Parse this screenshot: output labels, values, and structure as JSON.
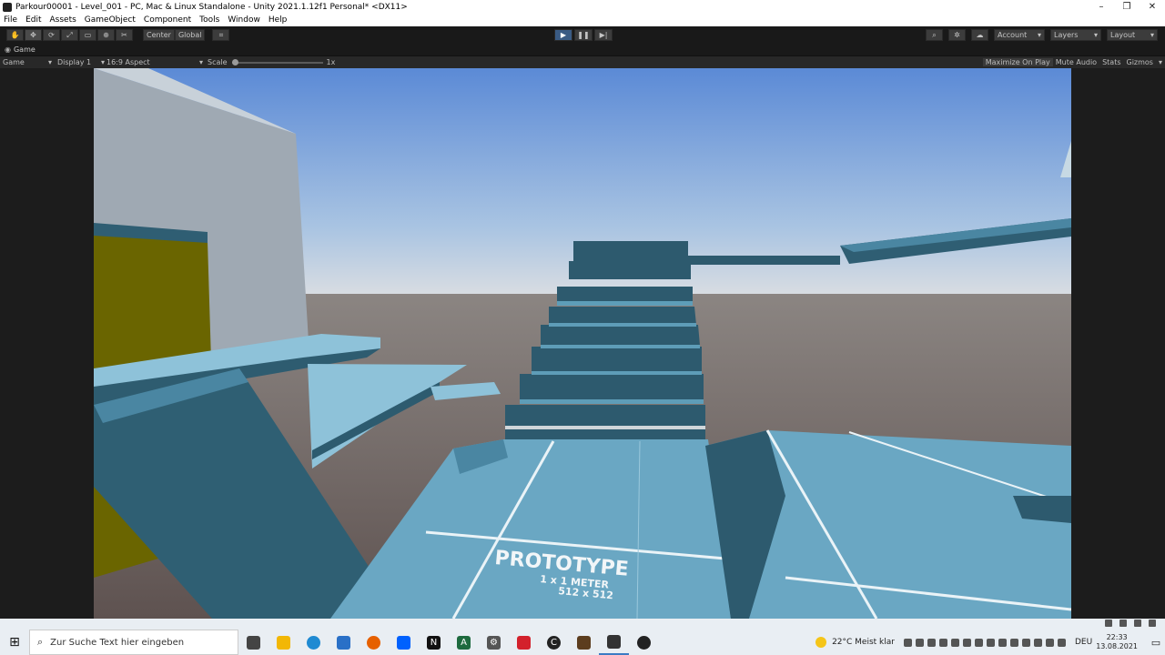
{
  "window": {
    "title": "Parkour00001 - Level_001 - PC, Mac & Linux Standalone - Unity 2021.1.12f1 Personal* <DX11>",
    "controls": [
      "–",
      "❐",
      "✕"
    ]
  },
  "menu": [
    "File",
    "Edit",
    "Assets",
    "GameObject",
    "Component",
    "Tools",
    "Window",
    "Help"
  ],
  "toolbar": {
    "tools": [
      {
        "name": "hand-tool",
        "glyph": "✋"
      },
      {
        "name": "move-tool",
        "glyph": "✥"
      },
      {
        "name": "rotate-tool",
        "glyph": "⟳"
      },
      {
        "name": "scale-tool",
        "glyph": "⤢"
      },
      {
        "name": "rect-tool",
        "glyph": "▭"
      },
      {
        "name": "transform-tool",
        "glyph": "⊕"
      },
      {
        "name": "custom-tool",
        "glyph": "✂"
      }
    ],
    "pivot_label": "Center",
    "space_label": "Global",
    "snap_glyph": "⌗",
    "play_glyph": "▶",
    "pause_glyph": "❚❚",
    "step_glyph": "▶|",
    "account_label": "Account",
    "layers_label": "Layers",
    "layout_label": "Layout"
  },
  "game_tab": {
    "label": "Game"
  },
  "game_toolbar": {
    "view_select": "Game",
    "display": "Display 1",
    "aspect": "16:9 Aspect",
    "scale_label": "Scale",
    "scale_value": "1x",
    "maximize": "Maximize On Play",
    "mute": "Mute Audio",
    "stats": "Stats",
    "gizmos": "Gizmos"
  },
  "scene": {
    "texture_text": "PROTOTYPE",
    "texture_sub1": "1 x 1 METER",
    "texture_sub2": "512 x 512"
  },
  "taskbar": {
    "search_placeholder": "Zur Suche Text hier eingeben",
    "apps": [
      {
        "name": "task-view",
        "color": "#444"
      },
      {
        "name": "file-explorer",
        "color": "#f2b705"
      },
      {
        "name": "edge",
        "color": "#1f8ad2"
      },
      {
        "name": "mail",
        "color": "#2a70c7"
      },
      {
        "name": "firefox",
        "color": "#e66000"
      },
      {
        "name": "dropbox",
        "color": "#0061fe"
      },
      {
        "name": "notion",
        "color": "#111"
      },
      {
        "name": "app-a",
        "color": "#1d6a3e"
      },
      {
        "name": "settings",
        "color": "#555"
      },
      {
        "name": "acrobat",
        "color": "#d3212c"
      },
      {
        "name": "app-c",
        "color": "#222"
      },
      {
        "name": "blender-like",
        "color": "#5c3d1e"
      },
      {
        "name": "unity-hub",
        "color": "#333"
      },
      {
        "name": "obs",
        "color": "#222"
      }
    ],
    "weather": "22°C  Meist klar",
    "language": "DEU",
    "time": "22:33",
    "date": "13.08.2021"
  }
}
